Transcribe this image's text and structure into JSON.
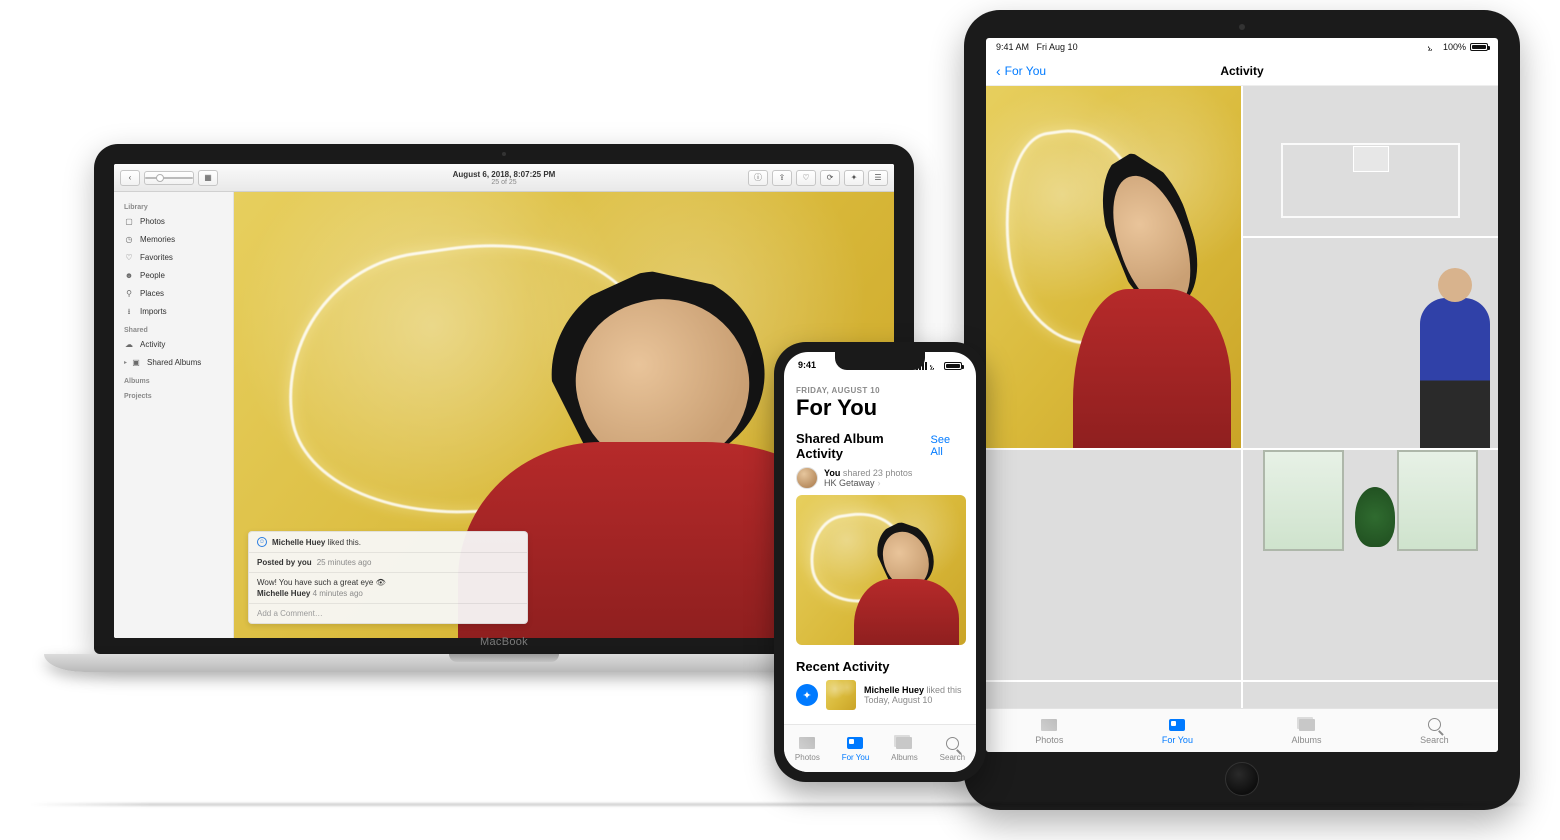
{
  "macbook": {
    "brand": "MacBook",
    "toolbar": {
      "title": "August 6, 2018, 8:07:25 PM",
      "subtitle": "25 of 25",
      "back_icon": "chevron-left",
      "info_icon": "info",
      "share_icon": "share",
      "fav_icon": "heart",
      "rotate_icon": "rotate",
      "enhance_icon": "magic-wand",
      "grid_icon": "grid",
      "zoom_position_pct": 22
    },
    "sidebar": {
      "groups": [
        {
          "header": "Library",
          "items": [
            {
              "icon": "photos",
              "label": "Photos"
            },
            {
              "icon": "memories",
              "label": "Memories"
            },
            {
              "icon": "heart",
              "label": "Favorites"
            },
            {
              "icon": "person",
              "label": "People"
            },
            {
              "icon": "pin",
              "label": "Places"
            },
            {
              "icon": "import",
              "label": "Imports"
            }
          ]
        },
        {
          "header": "Shared",
          "items": [
            {
              "icon": "cloud",
              "label": "Activity"
            },
            {
              "icon": "album",
              "label": "Shared Albums",
              "disclosure": true
            }
          ]
        },
        {
          "header": "Albums",
          "items": []
        },
        {
          "header": "Projects",
          "items": []
        }
      ]
    },
    "comment_card": {
      "liked_by_name": "Michelle Huey",
      "liked_suffix": " liked this.",
      "posted_by_label": "Posted by you",
      "posted_by_time": "25 minutes ago",
      "comment_author": "Michelle Huey",
      "comment_text": "Wow! You have such a great eye 👁",
      "comment_time": "4 minutes ago",
      "add_comment_placeholder": "Add a Comment…"
    }
  },
  "iphone": {
    "status": {
      "time": "9:41"
    },
    "overline": "FRIDAY, AUGUST 10",
    "title": "For You",
    "sections": {
      "shared": {
        "heading": "Shared Album Activity",
        "see_all": "See All",
        "item": {
          "author": "You",
          "suffix": " shared 23 photos",
          "album": "HK Getaway"
        }
      },
      "recent": {
        "heading": "Recent Activity",
        "item": {
          "author": "Michelle Huey",
          "suffix": " liked this",
          "when": "Today, August 10"
        }
      }
    },
    "tabs": [
      {
        "id": "photos",
        "label": "Photos",
        "active": false
      },
      {
        "id": "foryou",
        "label": "For You",
        "active": true
      },
      {
        "id": "albums",
        "label": "Albums",
        "active": false
      },
      {
        "id": "search",
        "label": "Search",
        "active": false
      }
    ]
  },
  "ipad": {
    "status": {
      "time": "9:41 AM",
      "date": "Fri Aug 10",
      "battery": "100%"
    },
    "nav": {
      "back": "For You",
      "title": "Activity"
    },
    "tabs": [
      {
        "id": "photos",
        "label": "Photos",
        "active": false
      },
      {
        "id": "foryou",
        "label": "For You",
        "active": true
      },
      {
        "id": "albums",
        "label": "Albums",
        "active": false
      },
      {
        "id": "search",
        "label": "Search",
        "active": false
      }
    ]
  },
  "colors": {
    "ios_blue": "#007aff",
    "hero_bg_warm": "#d9b93a",
    "shirt_red": "#b62a2a"
  }
}
